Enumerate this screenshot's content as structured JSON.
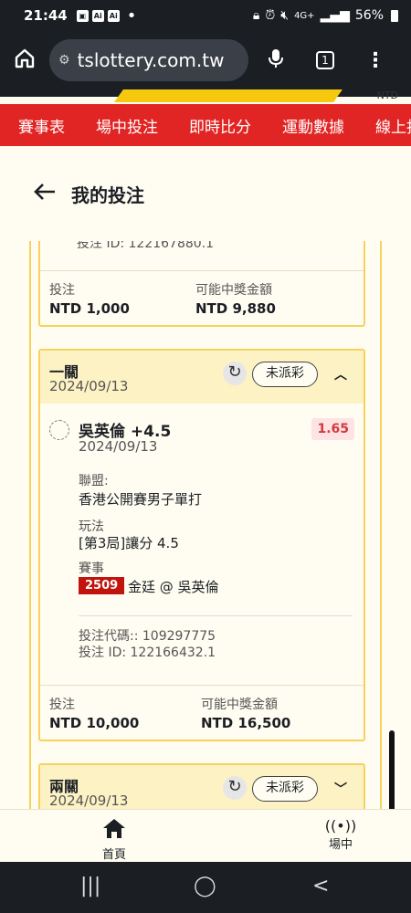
{
  "status": {
    "time": "21:44",
    "battery": "56%"
  },
  "browser": {
    "url": "tslottery.com.tw",
    "tab_count": "1"
  },
  "site": {
    "currency_hint": "NTD"
  },
  "nav": [
    "賽事表",
    "場中投注",
    "即時比分",
    "運動數據",
    "線上指"
  ],
  "page": {
    "title": "我的投注"
  },
  "card1": {
    "partial_line": "投注 ID: 122167880.1",
    "stake_label": "投注",
    "stake": "NTD 1,000",
    "payout_label": "可能中獎金額",
    "payout": "NTD 9,880"
  },
  "card2": {
    "type": "一關",
    "date": "2024/09/13",
    "status": "未派彩",
    "selection": "吳英倫 +4.5",
    "sel_date": "2024/09/13",
    "odds": "1.65",
    "league_label": "聯盟:",
    "league": "香港公開賽男子單打",
    "market_label": "玩法",
    "market": "[第3局]讓分 4.5",
    "event_label": "賽事",
    "event_no": "2509",
    "event": "金廷 @ 吳英倫",
    "bet_code": "投注代碼:: 109297775",
    "bet_id": "投注 ID: 122166432.1",
    "stake_label": "投注",
    "stake": "NTD 10,000",
    "payout_label": "可能中獎金額",
    "payout": "NTD 16,500"
  },
  "card3": {
    "type": "兩關",
    "date": "2024/09/13",
    "status": "未派彩"
  },
  "tabbar": {
    "home": "首頁",
    "live": "場中"
  }
}
